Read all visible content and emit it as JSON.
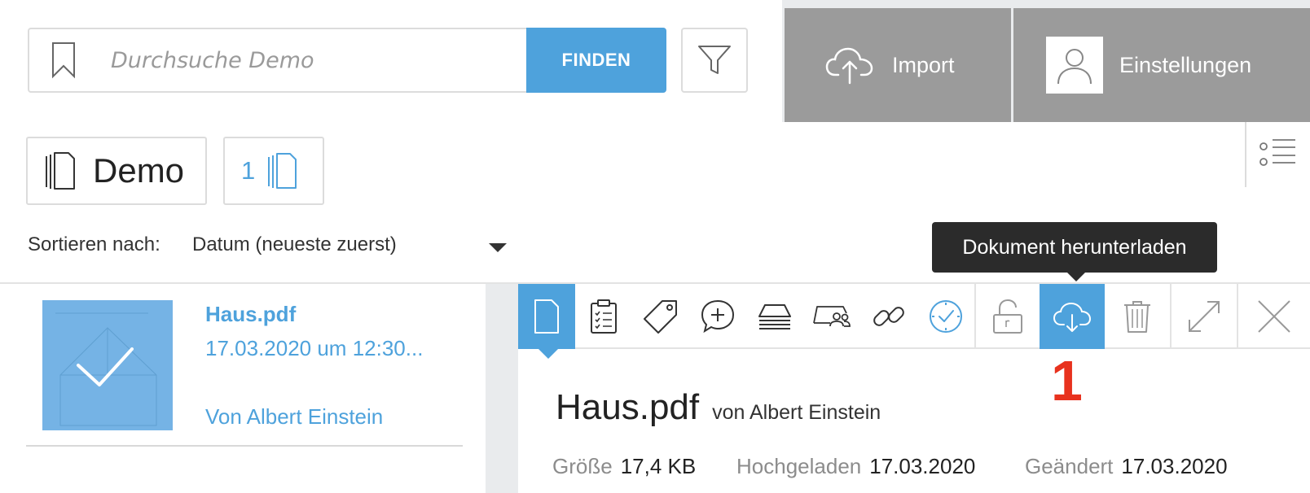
{
  "search": {
    "placeholder": "Durchsuche Demo",
    "find_label": "FINDEN"
  },
  "header": {
    "import_label": "Import",
    "settings_label": "Einstellungen"
  },
  "folder": {
    "name": "Demo",
    "document_count": "1"
  },
  "sort": {
    "label": "Sortieren nach:",
    "selected": "Datum (neueste zuerst)"
  },
  "tooltip": {
    "text": "Dokument herunterladen"
  },
  "documents": [
    {
      "name": "Haus.pdf",
      "date": "17.03.2020 um 12:30...",
      "author": "Von Albert Einstein"
    }
  ],
  "toolbar": {
    "icons": [
      "document-icon",
      "clipboard-icon",
      "tag-icon",
      "comment-add-icon",
      "stack-icon",
      "people-icon",
      "link-icon",
      "clock-check-icon",
      "unlock-icon",
      "cloud-download-icon",
      "trash-icon",
      "expand-icon",
      "close-icon"
    ],
    "active": "document-icon",
    "highlighted": "cloud-download-icon",
    "accent_color": "#4ea2dc"
  },
  "annotation": {
    "number": "1",
    "color": "#e8321e"
  },
  "detail": {
    "title": "Haus.pdf",
    "by": "von Albert Einstein",
    "size_label": "Größe",
    "size_value": "17,4 KB",
    "uploaded_label": "Hochgeladen",
    "uploaded_value": "17.03.2020",
    "changed_label": "Geändert",
    "changed_value": "17.03.2020"
  }
}
